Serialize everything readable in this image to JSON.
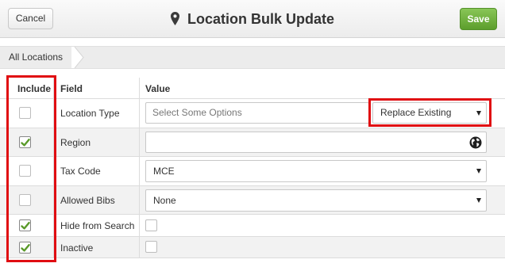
{
  "header": {
    "cancel_label": "Cancel",
    "title": "Location Bulk Update",
    "title_icon": "map-pin-icon",
    "save_label": "Save"
  },
  "breadcrumb": {
    "items": [
      "All Locations"
    ]
  },
  "table": {
    "headers": {
      "include": "Include",
      "field": "Field",
      "value": "Value"
    },
    "rows": [
      {
        "field": "Location Type",
        "included": false,
        "value_type": "multiselect",
        "placeholder": "Select Some Options",
        "mode_options_selected": "Replace Existing"
      },
      {
        "field": "Region",
        "included": true,
        "value_type": "region-picker",
        "value": "",
        "icon": "globe-icon"
      },
      {
        "field": "Tax Code",
        "included": false,
        "value_type": "select",
        "value": "MCE"
      },
      {
        "field": "Allowed Bibs",
        "included": false,
        "value_type": "select",
        "value": "None"
      },
      {
        "field": "Hide from Search",
        "included": true,
        "value_type": "checkbox",
        "value": false
      },
      {
        "field": "Inactive",
        "included": true,
        "value_type": "checkbox",
        "value": false
      }
    ]
  },
  "colors": {
    "save_green": "#6aab3c",
    "highlight_red": "#e00d12",
    "check_green": "#5a9a2a"
  }
}
